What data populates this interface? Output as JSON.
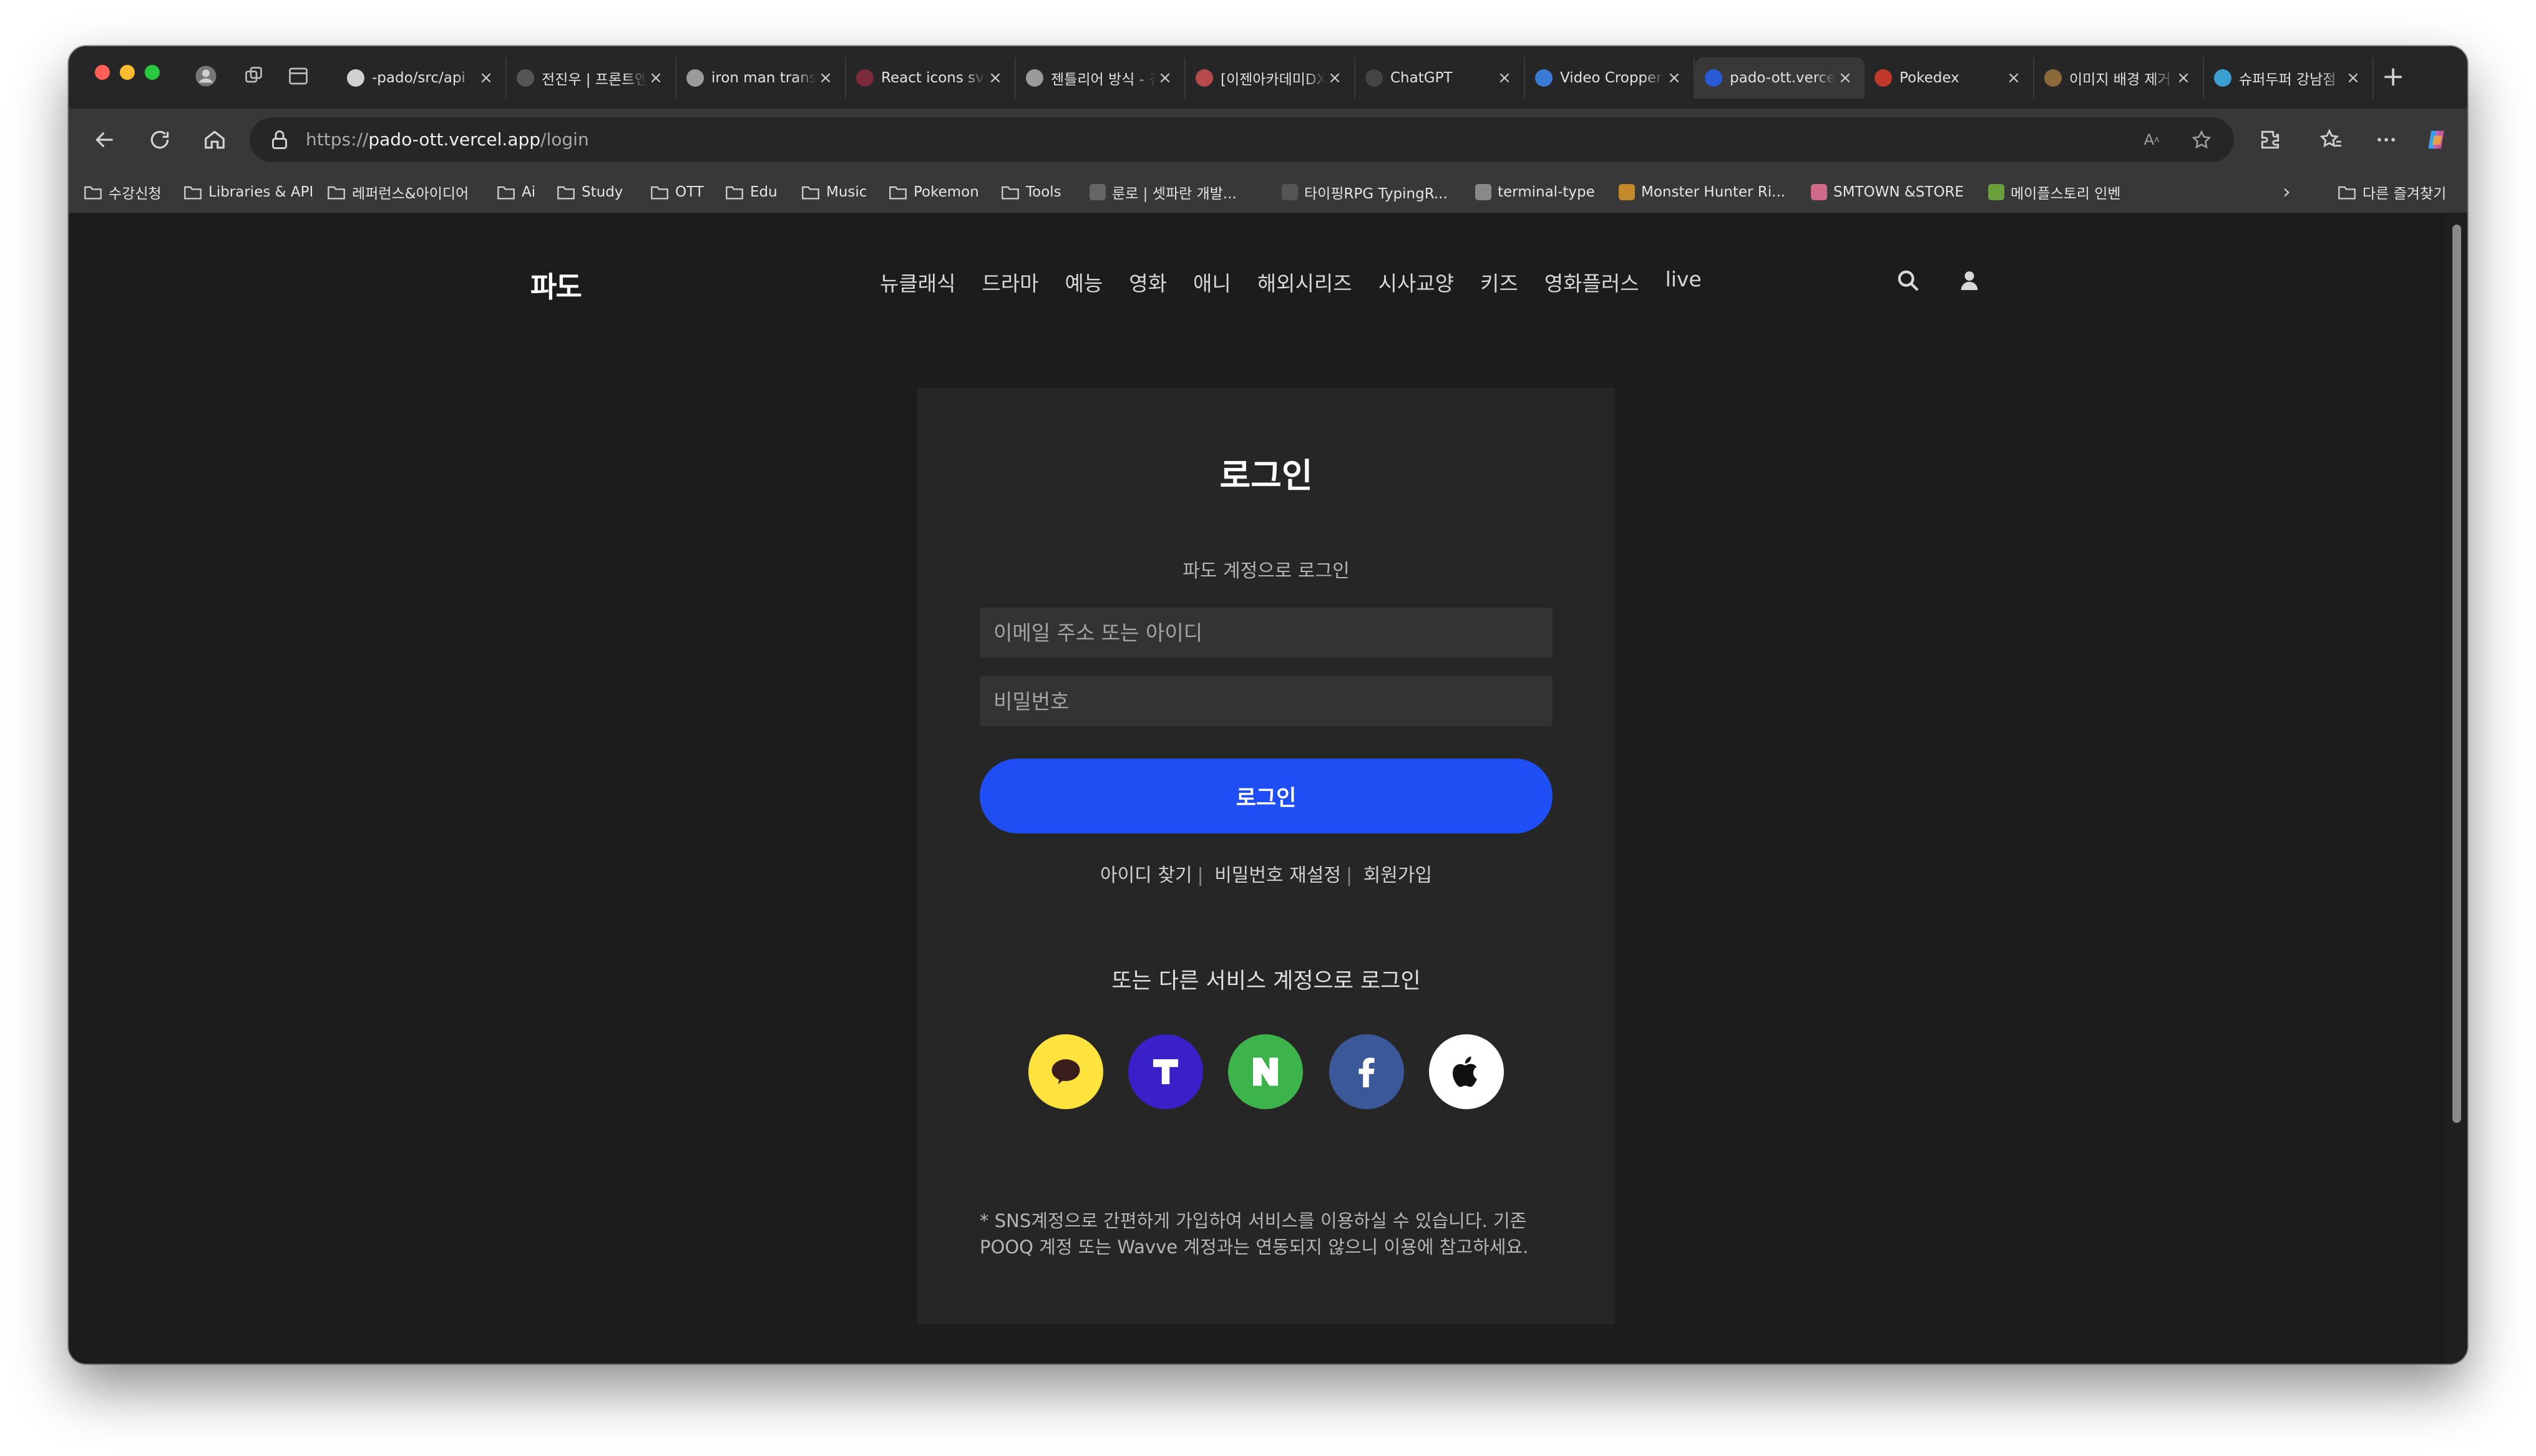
{
  "browser": {
    "tabs": [
      {
        "title": "-pado/src/api",
        "favicon": "github-icon",
        "color": "#d0d0d0"
      },
      {
        "title": "전진우 | 프론트엔드",
        "favicon": "dark-square-icon",
        "color": "#555555"
      },
      {
        "title": "iron man transparent",
        "favicon": "google-icon",
        "color": "#9a9a9a"
      },
      {
        "title": "React icons svg",
        "favicon": "react-icon",
        "color": "#7a2a3a"
      },
      {
        "title": "젠틀리어 방식 - 검색",
        "favicon": "google-icon",
        "color": "#9a9a9a"
      },
      {
        "title": "[이젠아카데미DX]",
        "favicon": "gmail-icon",
        "color": "#b64a4a"
      },
      {
        "title": "ChatGPT",
        "favicon": "chatgpt-icon",
        "color": "#444444"
      },
      {
        "title": "Video Cropper",
        "favicon": "video-cropper-icon",
        "color": "#3a7bd5"
      },
      {
        "title": "pado-ott.vercel.app",
        "favicon": "pado-icon",
        "color": "#2a5bd7",
        "active": true
      },
      {
        "title": "Pokedex",
        "favicon": "pokedex-icon",
        "color": "#c0392b"
      },
      {
        "title": "이미지 배경 제거",
        "favicon": "image-icon",
        "color": "#8a6a3a"
      },
      {
        "title": "슈퍼두퍼 강남점",
        "favicon": "superduper-icon",
        "color": "#3aa0d0"
      }
    ],
    "new_tab": "+",
    "url_prefix": "https://",
    "url_host": "pado-ott.vercel.app",
    "url_path": "/login",
    "bookmarks": [
      {
        "label": "수강신청",
        "icon": "folder-icon"
      },
      {
        "label": "Libraries & API",
        "icon": "folder-icon"
      },
      {
        "label": "레퍼런스&아이디어",
        "icon": "folder-icon"
      },
      {
        "label": "Ai",
        "icon": "folder-icon"
      },
      {
        "label": "Study",
        "icon": "folder-icon"
      },
      {
        "label": "OTT",
        "icon": "folder-icon"
      },
      {
        "label": "Edu",
        "icon": "folder-icon"
      },
      {
        "label": "Music",
        "icon": "folder-icon"
      },
      {
        "label": "Pokemon",
        "icon": "folder-icon"
      },
      {
        "label": "Tools",
        "icon": "folder-icon"
      },
      {
        "label": "룬로 | 셋파란 개발...",
        "icon": "site-icon",
        "color": "#666666"
      },
      {
        "label": "타이핑RPG TypingR...",
        "icon": "site-icon",
        "color": "#555555"
      },
      {
        "label": "terminal-type",
        "icon": "site-icon",
        "color": "#888888"
      },
      {
        "label": "Monster Hunter Ri...",
        "icon": "site-icon",
        "color": "#c48a2a"
      },
      {
        "label": "SMTOWN &STORE",
        "icon": "site-icon",
        "color": "#d06a8a"
      },
      {
        "label": "메이플스토리 인벤",
        "icon": "site-icon",
        "color": "#6aa03a"
      }
    ],
    "other_bookmarks": "다른 즐겨찾기"
  },
  "header": {
    "logo": "파도",
    "nav": [
      "뉴클래식",
      "드라마",
      "예능",
      "영화",
      "애니",
      "해외시리즈",
      "시사교양",
      "키즈",
      "영화플러스",
      "live"
    ]
  },
  "login": {
    "title": "로그인",
    "subtitle": "파도 계정으로 로그인",
    "email_placeholder": "이메일 주소 또는 아이디",
    "password_placeholder": "비밀번호",
    "submit_label": "로그인",
    "find_id": "아이디 찾기",
    "reset_password": "비밀번호 재설정",
    "signup": "회원가입",
    "sns_title": "또는 다른 서비스 계정으로 로그인",
    "sns": [
      {
        "name": "kakao",
        "color": "#fee23e"
      },
      {
        "name": "tworld",
        "color": "#3a20c8"
      },
      {
        "name": "naver",
        "color": "#3db34b"
      },
      {
        "name": "facebook",
        "color": "#3b5998"
      },
      {
        "name": "apple",
        "color": "#ffffff"
      }
    ],
    "notice_line1": "* SNS계정으로 간편하게 가입하여 서비스를 이용하실 수 있습니다. 기존",
    "notice_line2": "POOQ 계정 또는 Wavve 계정과는 연동되지 않으니 이용에 참고하세요."
  }
}
